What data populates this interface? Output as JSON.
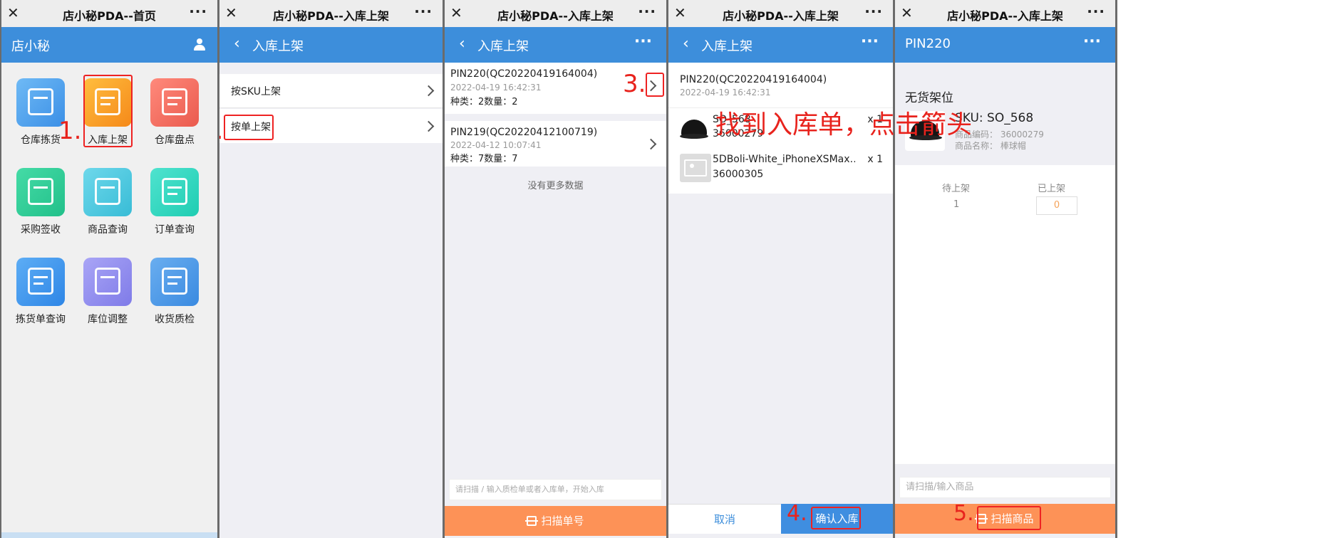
{
  "screens": [
    {
      "wx_title": "店小秘PDA--首页",
      "nav_title": "店小秘",
      "grid": [
        {
          "label": "仓库拣货",
          "icon": "cart-icon",
          "color": "#4ea3ea"
        },
        {
          "label": "入库上架",
          "icon": "house-upload-icon",
          "color": "#f7a021"
        },
        {
          "label": "仓库盘点",
          "icon": "calculator-icon",
          "color": "#f0675b"
        },
        {
          "label": "采购签收",
          "icon": "check-card-icon",
          "color": "#2fcf9a"
        },
        {
          "label": "商品查询",
          "icon": "search-box-icon",
          "color": "#46c8de"
        },
        {
          "label": "订单查询",
          "icon": "order-doc-icon",
          "color": "#2ed8c2"
        },
        {
          "label": "拣货单查询",
          "icon": "list-doc-icon",
          "color": "#3d95ee"
        },
        {
          "label": "库位调整",
          "icon": "swap-icon",
          "color": "#8f8cf0"
        },
        {
          "label": "收货质检",
          "icon": "inspect-box-icon",
          "color": "#4a98e8"
        }
      ]
    },
    {
      "wx_title": "店小秘PDA--入库上架",
      "nav_title": "入库上架",
      "rows": [
        "按SKU上架",
        "按单上架"
      ]
    },
    {
      "wx_title": "店小秘PDA--入库上架",
      "nav_title": "入库上架",
      "orders": [
        {
          "id": "PIN220(QC20220419164004)",
          "time": "2022-04-19 16:42:31",
          "summary": "种类：2数量：2"
        },
        {
          "id": "PIN219(QC20220412100719)",
          "time": "2022-04-12 10:07:41",
          "summary": "种类：7数量：7"
        }
      ],
      "no_more": "没有更多数据",
      "input_placeholder": "请扫描 / 输入质检单或者入库单，开始入库",
      "scan_btn": "扫描单号"
    },
    {
      "wx_title": "店小秘PDA--入库上架",
      "nav_title": "入库上架",
      "order_id": "PIN220(QC20220419164004)",
      "order_time": "2022-04-19 16:42:31",
      "items": [
        {
          "sku": "SO_568",
          "code": "36000279",
          "qty": "x 1"
        },
        {
          "sku": "5DBoli-White_iPhoneXSMax…",
          "code": "36000305",
          "qty": "x 1"
        }
      ],
      "cancel": "取消",
      "confirm": "确认入库"
    },
    {
      "wx_title": "店小秘PDA--入库上架",
      "nav_title": "PIN220",
      "shelf": "无货架位",
      "sku_line": "SKU: SO_568",
      "code_line": "商品编码： 36000279",
      "name_line": "商品名称： 棒球帽",
      "pending_label": "待上架",
      "pending_val": "1",
      "done_label": "已上架",
      "done_val": "0",
      "input_placeholder": "请扫描/输入商品",
      "scan_btn": "扫描商品"
    }
  ],
  "annotations": {
    "step1": "1.",
    "step2": "2.",
    "step3": "3.",
    "step3_text": "找到入库单，点击箭头",
    "step4": "4.",
    "step5": "5."
  },
  "colors": {
    "nav_blue": "#3d8edb",
    "scan_orange": "#fd9257",
    "confirm_blue": "#3f8ee0",
    "annotation_red": "#e8231d",
    "shelved_value": "#f5a35a"
  }
}
